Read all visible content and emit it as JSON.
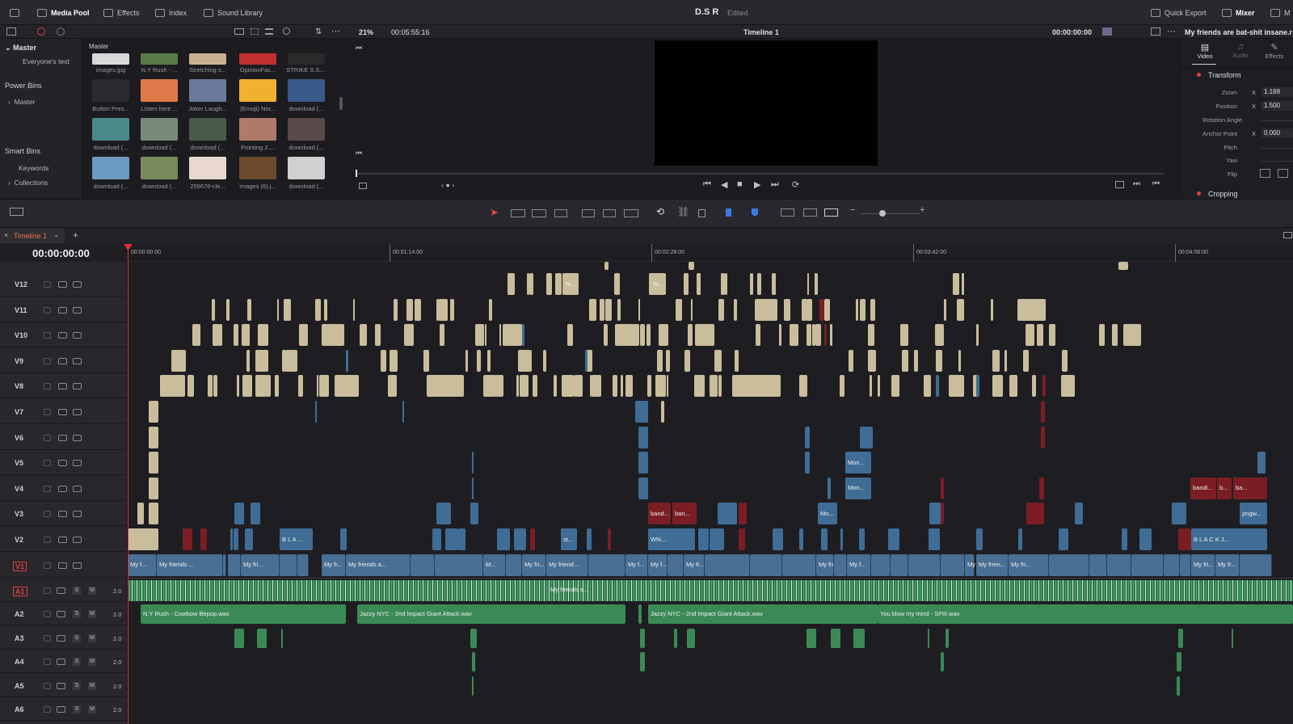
{
  "topbar": {
    "media_pool": "Media Pool",
    "effects": "Effects",
    "index": "Index",
    "sound_library": "Sound Library",
    "project_title": "D.S R",
    "edited": "Edited",
    "quick_export": "Quick Export",
    "mixer": "Mixer",
    "metadata_short": "M"
  },
  "subbar": {
    "zoom": "21%",
    "duration": "00:05:55:16",
    "timeline_name": "Timeline 1",
    "timecode": "00:00:00:00",
    "clip_name": "My friends are bat-shit insane.r"
  },
  "sidebar": {
    "master": "Master",
    "everyones_text": "Everyone's text",
    "power_bins": "Power Bins",
    "power_master": "Master",
    "smart_bins": "Smart Bins",
    "keywords": "Keywords",
    "collections": "Collections"
  },
  "pool": {
    "header": "Master",
    "items": [
      {
        "label": "images.jpg",
        "color": "#d8d8d8"
      },
      {
        "label": "N.Y Rush - ...",
        "color": "#5a7a4a"
      },
      {
        "label": "Stretching s...",
        "color": "#c8b090"
      },
      {
        "label": "OpinionFac...",
        "color": "#c03030"
      },
      {
        "label": "STRIKE S.S....",
        "color": "#2a2a2a"
      },
      {
        "label": "Button Pres...",
        "color": "#2a2a2e"
      },
      {
        "label": "Listen here ...",
        "color": "#e07a4a"
      },
      {
        "label": "Joker Laugh...",
        "color": "#6a7a9a"
      },
      {
        "label": "(Emoji) Nor...",
        "color": "#f0b030"
      },
      {
        "label": "download (...",
        "color": "#3a5a8a"
      },
      {
        "label": "download (...",
        "color": "#4a8a8a"
      },
      {
        "label": "download (...",
        "color": "#7a8a7a"
      },
      {
        "label": "download (...",
        "color": "#4a5a4a"
      },
      {
        "label": "Pointing 2....",
        "color": "#b07a6a"
      },
      {
        "label": "download (...",
        "color": "#5a4a4a"
      },
      {
        "label": "download (...",
        "color": "#6a9ac0"
      },
      {
        "label": "download (...",
        "color": "#7a8a5a"
      },
      {
        "label": "259678-cle...",
        "color": "#e8d8d0"
      },
      {
        "label": "images (6).j...",
        "color": "#6a4a2a"
      },
      {
        "label": "download (...",
        "color": "#d0d0d0"
      }
    ]
  },
  "inspector": {
    "tab_video": "Video",
    "tab_audio": "Audio",
    "tab_effects": "Effects",
    "transform": "Transform",
    "zoom_label": "Zoom",
    "zoom_axis": "X",
    "zoom_value": "1.168",
    "position_label": "Position",
    "position_axis": "X",
    "position_value": "1.500",
    "rotation_label": "Rotation Angle",
    "anchor_label": "Anchor Point",
    "anchor_axis": "X",
    "anchor_value": "0.000",
    "pitch_label": "Pitch",
    "yaw_label": "Yaw",
    "flip_label": "Flip",
    "cropping": "Cropping"
  },
  "timeline": {
    "tab_name": "Timeline 1",
    "timecode": "00:00:00:00",
    "ruler": [
      "00:00:00:00",
      "00:01:14:00",
      "00:02:28:00",
      "00:03:42:00",
      "00:04:56:00"
    ],
    "video_tracks": [
      "V12",
      "V11",
      "V10",
      "V9",
      "V8",
      "V7",
      "V6",
      "V5",
      "V4",
      "V3",
      "V2",
      "V1"
    ],
    "audio_tracks": [
      "A1",
      "A2",
      "A3",
      "A4",
      "A5",
      "A6"
    ],
    "audio_level": "2.0",
    "solo": "S",
    "mute": "M",
    "clip_labels": {
      "v12a": "Te...",
      "v12b": "Te...",
      "v5a": "Mon...",
      "v4a": "Mon...",
      "v4r": "bandi...",
      "v4r2": "b...",
      "v4r3": "ba...",
      "v3a": "band...",
      "v3b": "ban...",
      "v3c": "Mo...",
      "v3d": "pngw...",
      "v2a": "B L A ...",
      "v2b": "st...",
      "v2c": "Whi...",
      "v2d": "B L A C K J...",
      "v1a": "My f...",
      "v1b": "My friends ...",
      "v1c": "My fri...",
      "v1d": "My fr...",
      "v1e": "My friends a...",
      "v1f": "M...",
      "v1g": "My fri...",
      "v1h": "My friend...",
      "v1i": "My f...",
      "v1j": "My f...",
      "v1k": "My fr...",
      "v1l": "My fri...",
      "v1m": "My f...",
      "v1n": "My frien...",
      "v1o": "My fri...",
      "v1p": "My fr...",
      "a1": "My friends a...",
      "a2a": "N.Y Rush - Cowbow Bepop.wav",
      "a2b": "Jazzy NYC - 2nd Impact Giant Attack.wav",
      "a2c": "Jazzy NYC - 2nd Impact Giant Attack.wav",
      "a2d": "You blow my mind - SFIII.wav"
    }
  }
}
